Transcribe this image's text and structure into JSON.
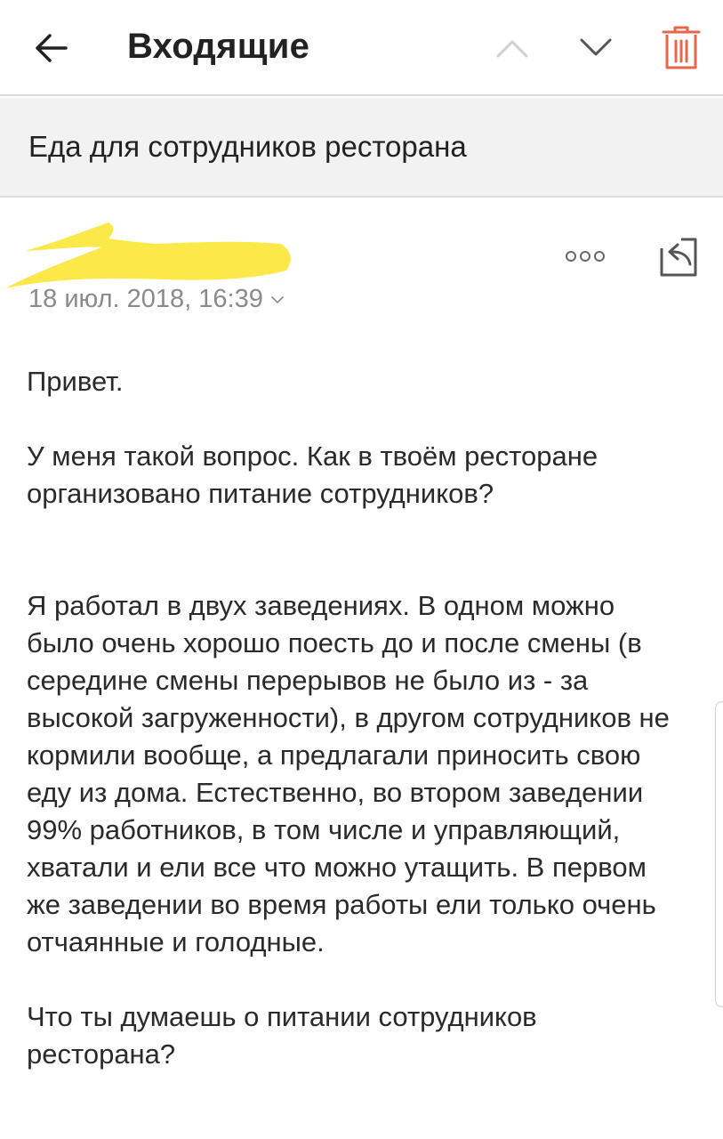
{
  "header": {
    "title": "Входящие",
    "icons": {
      "back": "arrow-left-icon",
      "prev": "chevron-up-icon",
      "next": "chevron-down-icon",
      "delete": "trash-icon"
    },
    "colors": {
      "prev_disabled": "#cfcfcf",
      "next": "#555555",
      "delete": "#e8664a"
    }
  },
  "subject": "Еда для сотрудников ресторана",
  "message": {
    "sender_redacted": true,
    "redaction_color": "#fbe94a",
    "date": "18 июл. 2018, 16:39",
    "more_icon": "more-dots-icon",
    "reply_icon": "reply-icon",
    "paragraphs": [
      "Привет.",
      "У меня такой вопрос. Как в твоём ресторане организовано питание сотрудников?",
      "Я работал в двух заведениях. В одном можно было очень хорошо поесть до и после смены (в середине смены перерывов не было из - за высокой загруженности), в другом сотрудников не кормили вообще, а предлагали приносить свою еду из дома. Естественно, во втором заведении 99% работников, в том числе и управляющий, хватали и ели все что можно утащить. В первом же заведении во время работы ели только очень отчаянные и голодные.",
      "Что ты думаешь о питании сотрудников ресторана?"
    ]
  }
}
